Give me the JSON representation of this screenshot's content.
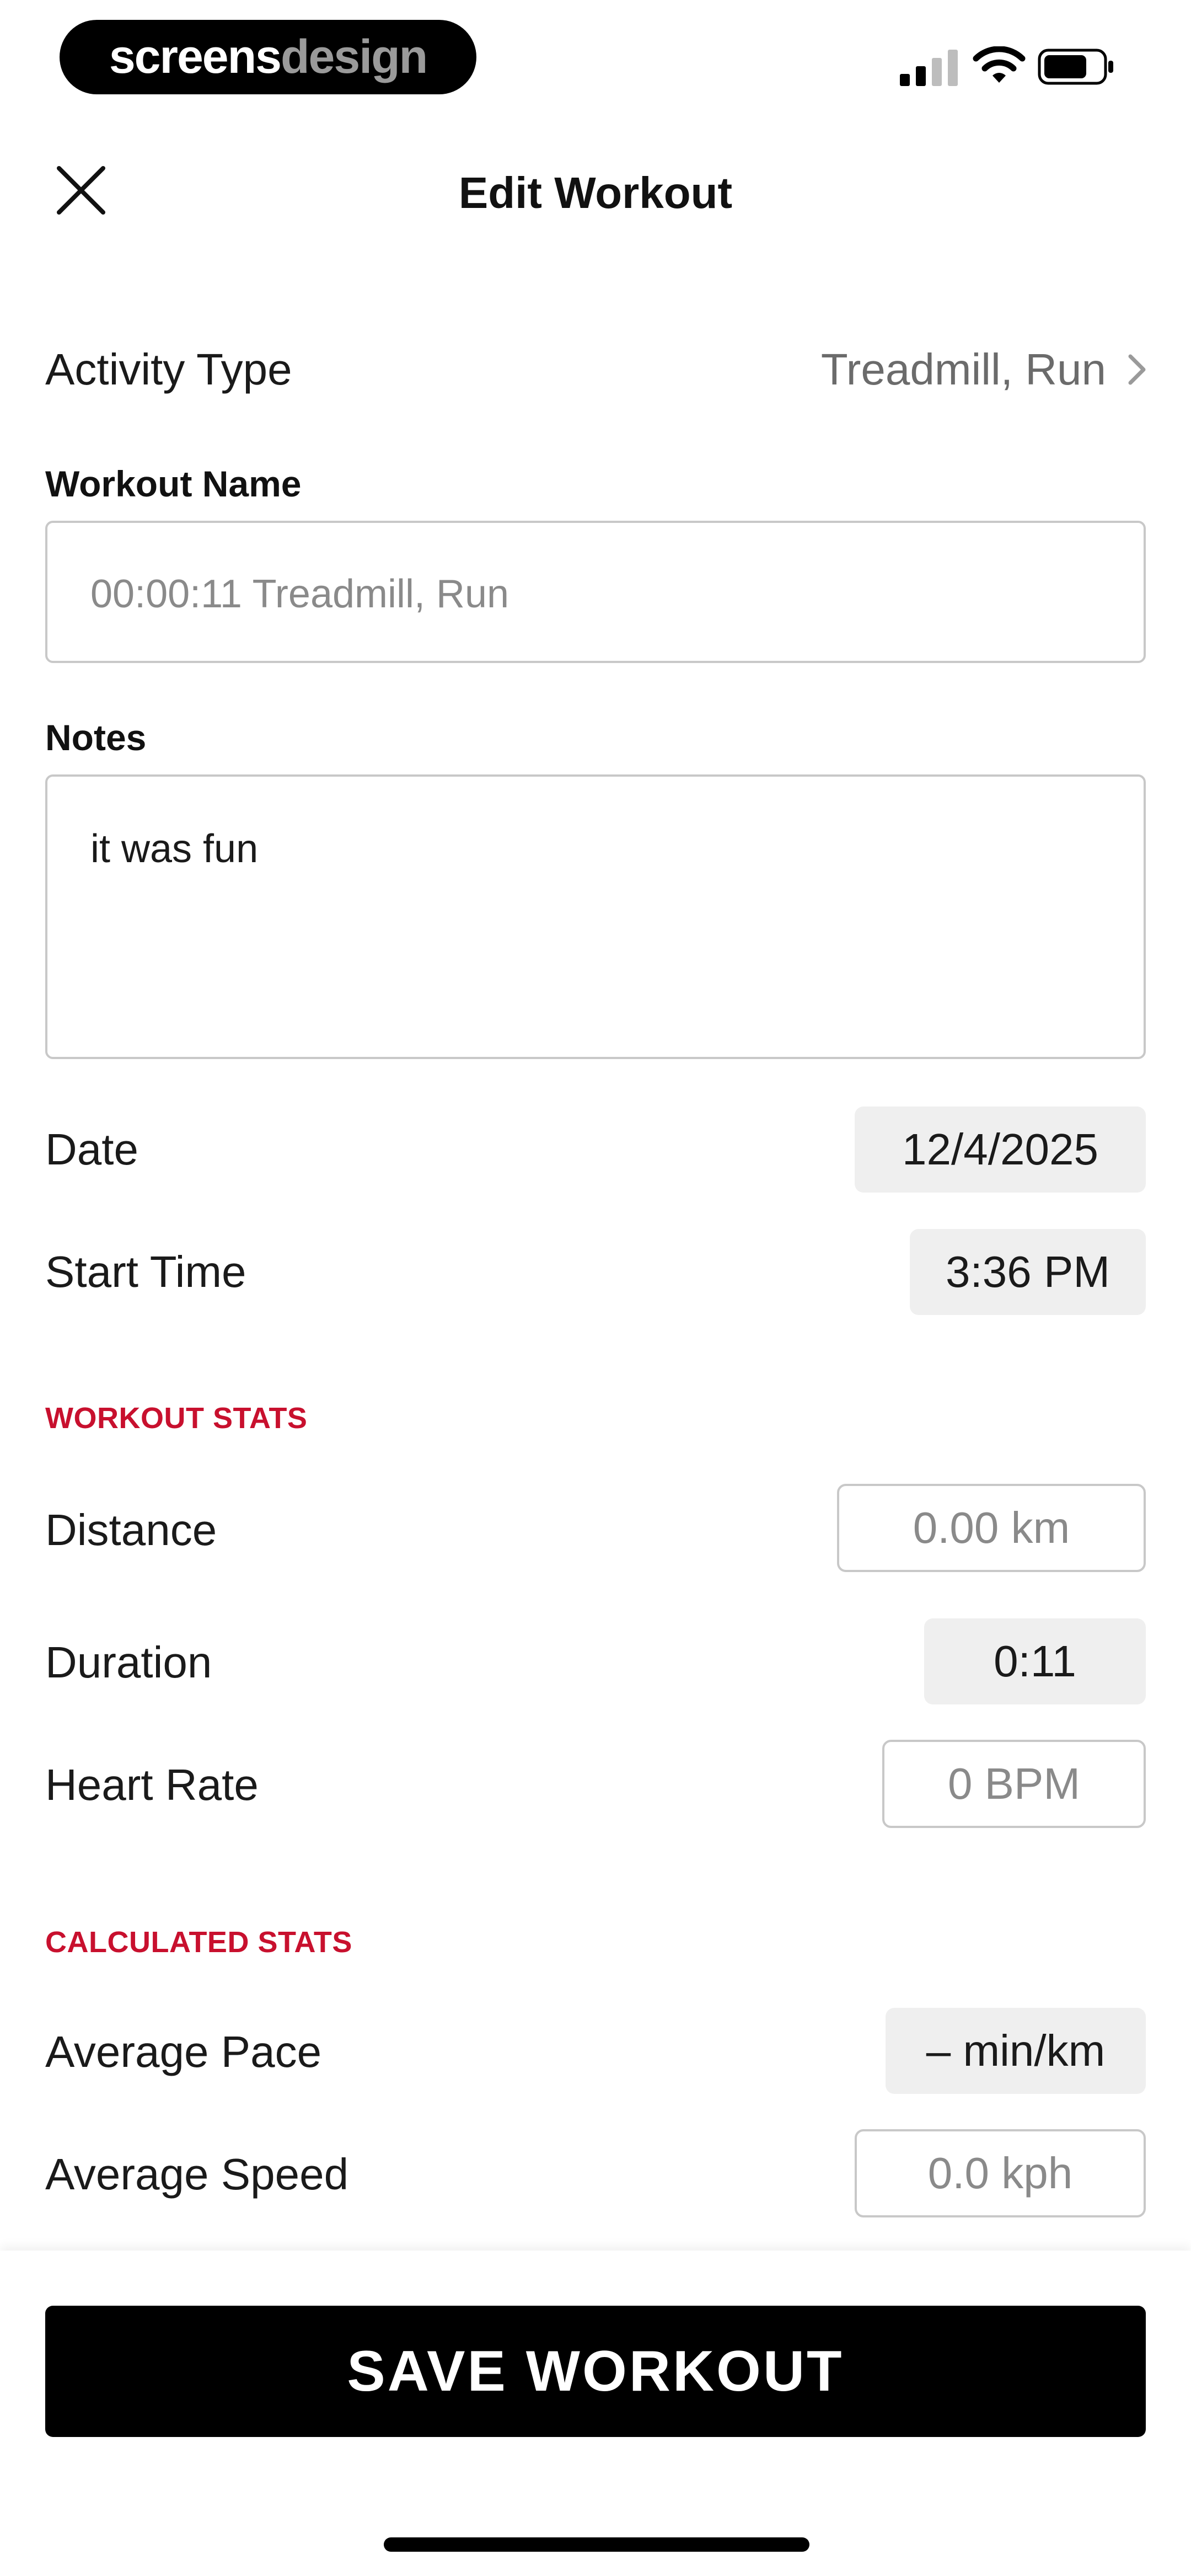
{
  "status_bar": {
    "brand_part1": "screens",
    "brand_part2": "design",
    "signal_icon": "signal-icon",
    "wifi_icon": "wifi-icon",
    "battery_icon": "battery-icon"
  },
  "header": {
    "title": "Edit Workout",
    "close_icon": "close-icon"
  },
  "activity": {
    "label": "Activity Type",
    "value": "Treadmill, Run",
    "chevron_icon": "chevron-right-icon"
  },
  "workout_name": {
    "label": "Workout Name",
    "placeholder": "00:00:11 Treadmill, Run"
  },
  "notes": {
    "label": "Notes",
    "value": "it was fun"
  },
  "date": {
    "label": "Date",
    "value": "12/4/2025"
  },
  "start_time": {
    "label": "Start Time",
    "value": "3:36 PM"
  },
  "workout_stats": {
    "heading": "WORKOUT STATS",
    "distance": {
      "label": "Distance",
      "placeholder": "0.00 km"
    },
    "duration": {
      "label": "Duration",
      "value": "0:11"
    },
    "heart_rate": {
      "label": "Heart Rate",
      "placeholder": "0 BPM"
    }
  },
  "calculated_stats": {
    "heading": "CALCULATED STATS",
    "average_pace": {
      "label": "Average Pace",
      "value": "– min/km"
    },
    "average_speed": {
      "label": "Average Speed",
      "placeholder": "0.0 kph"
    }
  },
  "footer": {
    "save_label": "SAVE WORKOUT"
  },
  "colors": {
    "accent_red": "#c8102e",
    "button_black": "#000000",
    "filled_field_bg": "#efefef"
  }
}
